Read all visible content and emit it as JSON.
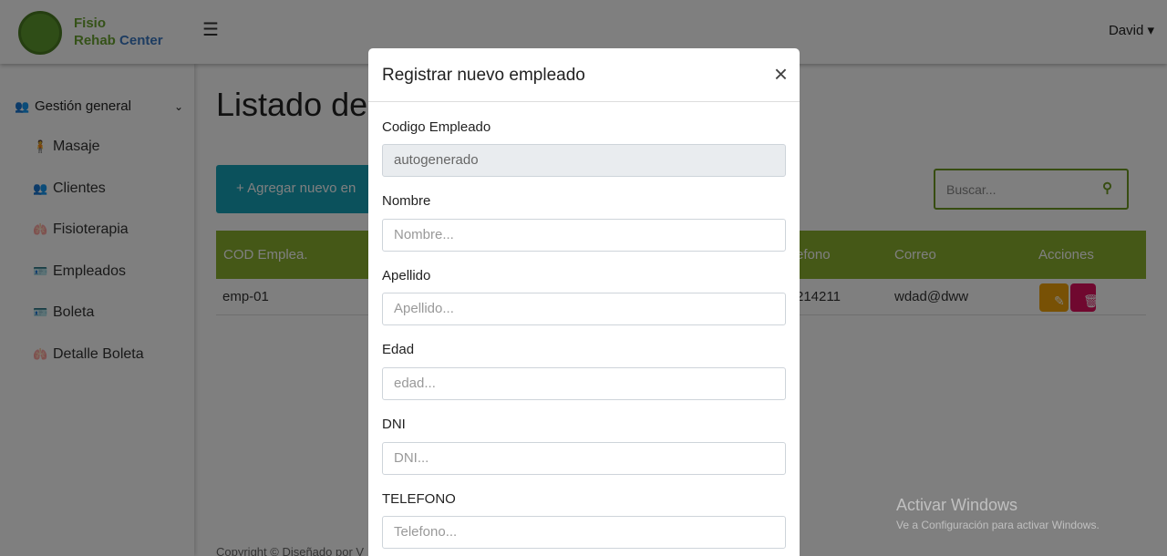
{
  "brand": {
    "line1": "Fisio",
    "line2a": "Rehab",
    "line2b": "Center"
  },
  "topbar": {
    "menu_icon": "☰",
    "user": "David ▾"
  },
  "sidebar": {
    "group": {
      "label": "Gestión general",
      "icon": "users-icon"
    },
    "items": [
      {
        "label": "Masaje",
        "icon": "person-icon"
      },
      {
        "label": "Clientes",
        "icon": "users-icon"
      },
      {
        "label": "Fisioterapia",
        "icon": "lungs-icon"
      },
      {
        "label": "Empleados",
        "icon": "id-card-icon"
      },
      {
        "label": "Boleta",
        "icon": "id-card-icon"
      },
      {
        "label": "Detalle Boleta",
        "icon": "lungs-icon"
      }
    ]
  },
  "main": {
    "title": "Listado de",
    "add_button": "+ Agregar nuevo en",
    "search_placeholder": "Buscar...",
    "table": {
      "headers": [
        "COD Emplea.",
        "efono",
        "Correo",
        "Acciones"
      ],
      "rows": [
        {
          "cod": "emp-01",
          "telefono": "214211",
          "correo": "wdad@dww"
        }
      ]
    },
    "footer": "Copyright © Diseñado por V"
  },
  "colors": {
    "accent": "#8ab12e",
    "info": "#17a2b8",
    "edit": "#f0a30a",
    "delete": "#e0115f"
  },
  "modal": {
    "title": "Registrar nuevo empleado",
    "close": "×",
    "fields": [
      {
        "label": "Codigo Empleado",
        "value": "autogenerado"
      },
      {
        "label": "Nombre",
        "placeholder": "Nombre..."
      },
      {
        "label": "Apellido",
        "placeholder": "Apellido..."
      },
      {
        "label": "Edad",
        "placeholder": "edad..."
      },
      {
        "label": "DNI",
        "placeholder": "DNI..."
      },
      {
        "label": "TELEFONO",
        "placeholder": "Telefono..."
      }
    ]
  },
  "watermark": {
    "line1": "Activar Windows",
    "line2": "Ve a Configuración para activar Windows."
  }
}
